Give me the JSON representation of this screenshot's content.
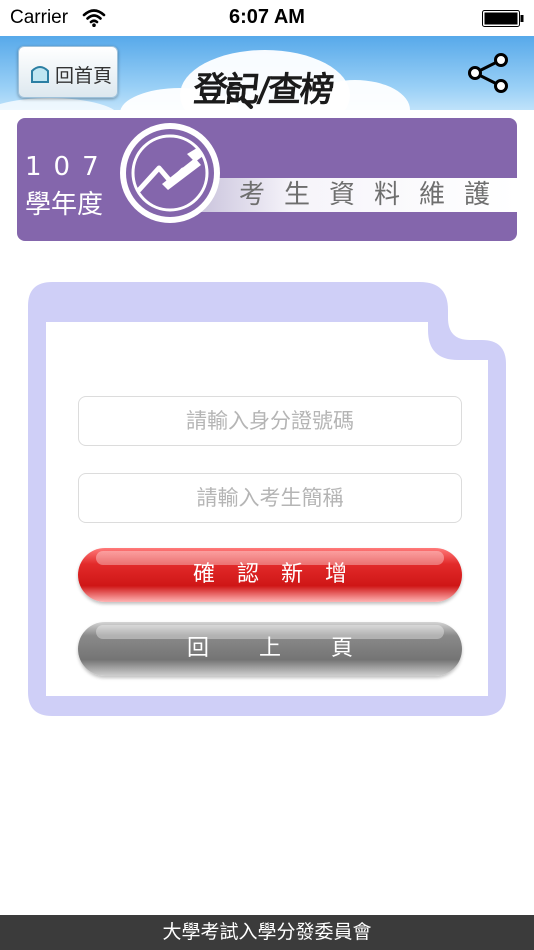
{
  "status_bar": {
    "carrier": "Carrier",
    "time": "6:07 AM"
  },
  "header": {
    "home_label": "回首頁",
    "logo_text": "登記/查榜",
    "share_icon": "share-icon"
  },
  "banner": {
    "year": "107",
    "term": "學年度",
    "title": "考生資料維護"
  },
  "form": {
    "id_placeholder": "請輸入身分證號碼",
    "name_placeholder": "請輸入考生簡稱",
    "confirm_label": "確認新增",
    "back_label": "回上頁"
  },
  "footer": {
    "text": "大學考試入學分發委員會"
  },
  "colors": {
    "header_blue": "#57a9ea",
    "banner_purple": "#8466ac",
    "card_lavender": "#cfcff7",
    "confirm_red": "#d81d1d",
    "back_gray": "#7a7a7a",
    "footer_dark": "#3b3b3b"
  }
}
